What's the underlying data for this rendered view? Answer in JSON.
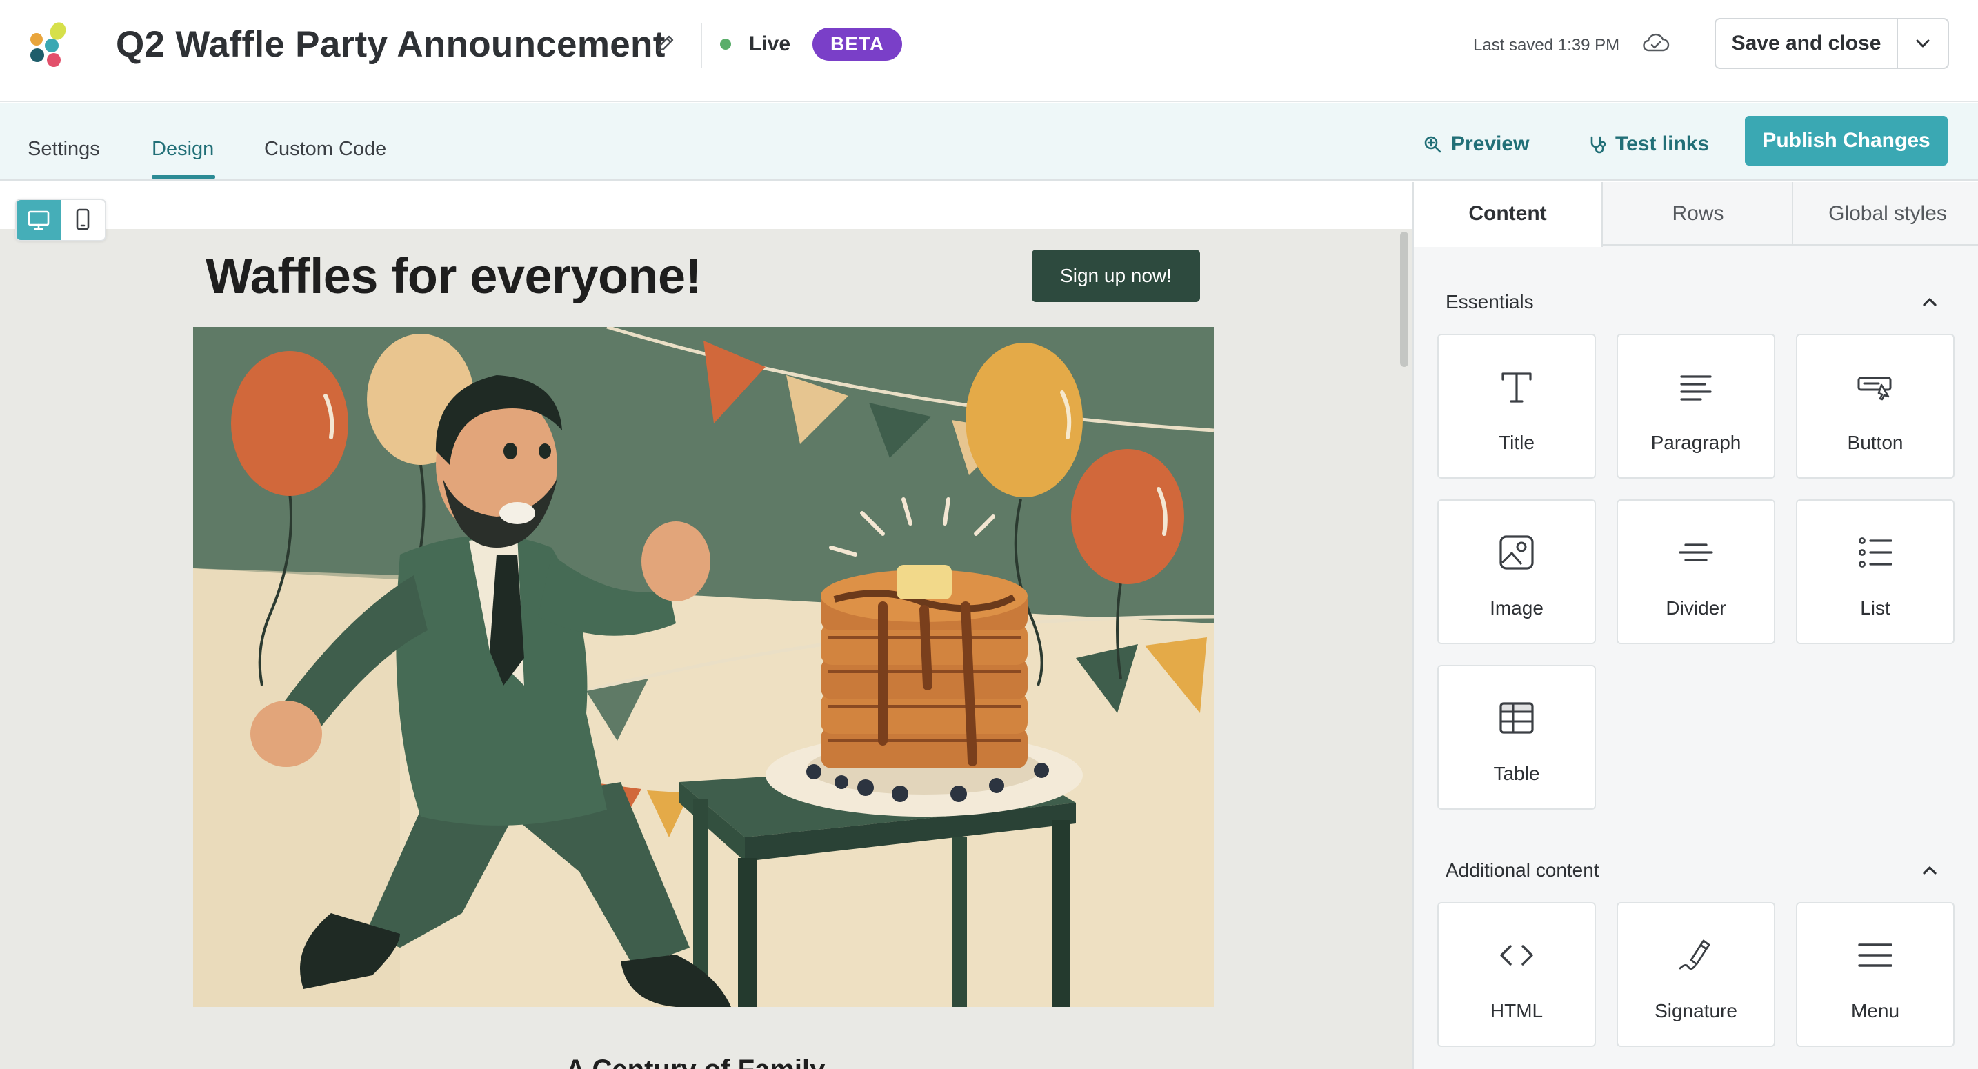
{
  "header": {
    "title": "Q2 Waffle Party Announcement",
    "status_label": "Live",
    "badge": "BETA",
    "last_saved": "Last saved 1:39 PM",
    "save_label": "Save and close",
    "icons": [
      "app-logo",
      "pencil-icon",
      "cloud-icon",
      "chevron-down-icon"
    ]
  },
  "tabs": {
    "items": [
      {
        "label": "Settings"
      },
      {
        "label": "Design",
        "active": true
      },
      {
        "label": "Custom Code"
      }
    ],
    "preview_label": "Preview",
    "test_links_label": "Test links",
    "publish_label": "Publish Changes"
  },
  "email": {
    "heading": "Waffles for everyone!",
    "cta_label": "Sign up now!",
    "subheading": "A Century of Family"
  },
  "panel": {
    "tabs": [
      {
        "label": "Content",
        "active": true
      },
      {
        "label": "Rows"
      },
      {
        "label": "Global styles"
      }
    ],
    "sections": [
      {
        "title": "Essentials",
        "items": [
          {
            "label": "Title",
            "icon": "title-icon"
          },
          {
            "label": "Paragraph",
            "icon": "paragraph-icon"
          },
          {
            "label": "Button",
            "icon": "button-icon"
          },
          {
            "label": "Image",
            "icon": "image-icon"
          },
          {
            "label": "Divider",
            "icon": "divider-icon"
          },
          {
            "label": "List",
            "icon": "list-icon"
          },
          {
            "label": "Table",
            "icon": "table-icon"
          }
        ]
      },
      {
        "title": "Additional content",
        "items": [
          {
            "label": "HTML",
            "icon": "code-icon"
          },
          {
            "label": "Signature",
            "icon": "signature-icon"
          },
          {
            "label": "Menu",
            "icon": "menu-icon"
          }
        ]
      }
    ]
  },
  "colors": {
    "accent": "#3aa8b3",
    "accent_text": "#216f77",
    "beta": "#7a3fc8",
    "live": "#5aae6a",
    "cta": "#2d4a3e",
    "hero_green": "#5f7a66"
  }
}
